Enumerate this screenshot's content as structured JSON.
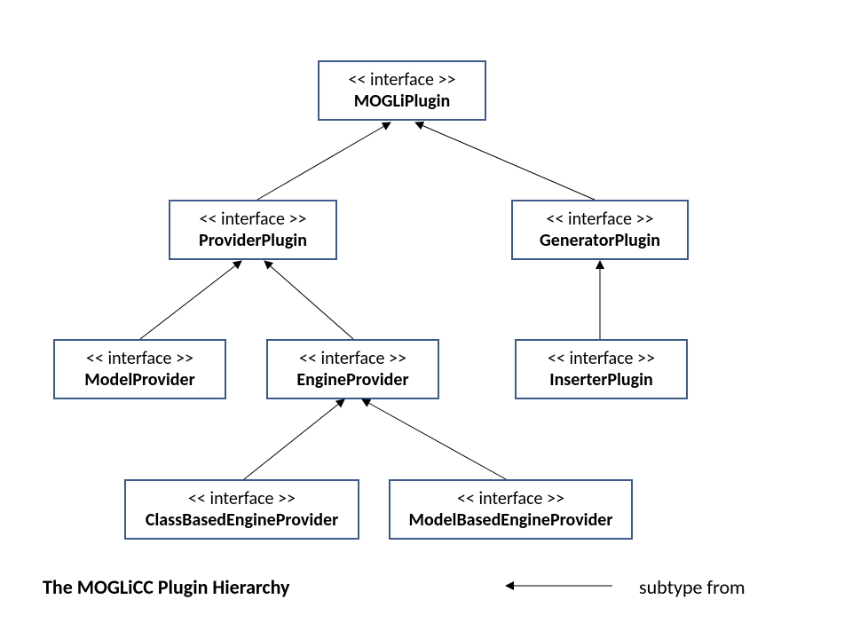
{
  "stereotype": "<< interface >>",
  "nodes": {
    "mogli": "MOGLiPlugin",
    "provider": "ProviderPlugin",
    "generator": "GeneratorPlugin",
    "model": "ModelProvider",
    "engine": "EngineProvider",
    "inserter": "InserterPlugin",
    "classBased": "ClassBasedEngineProvider",
    "modelBased": "ModelBasedEngineProvider"
  },
  "caption": "The MOGLiCC Plugin Hierarchy",
  "legend": "subtype from"
}
